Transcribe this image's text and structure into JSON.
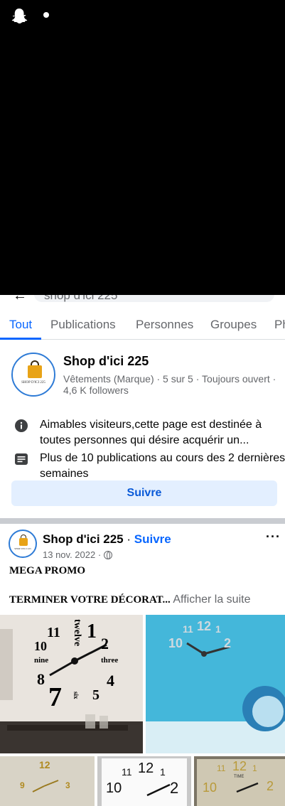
{
  "status_bar": {
    "icons": [
      "snapchat-ghost-icon",
      "notification-dot-icon"
    ]
  },
  "search": {
    "query": "shop d'ici 225"
  },
  "tabs": [
    {
      "label": "Tout",
      "active": true
    },
    {
      "label": "Publications",
      "active": false
    },
    {
      "label": "Personnes",
      "active": false
    },
    {
      "label": "Groupes",
      "active": false
    },
    {
      "label": "Ph",
      "active": false
    }
  ],
  "page_result": {
    "name": "Shop d'ici 225",
    "subtitle": "Vêtements (Marque) · 5 sur 5 · Toujours ouvert · 4,6 K followers",
    "logo_text": "SHOP D'ICI 225",
    "info_about": "Aimables visiteurs,cette page est destinée à toutes personnes qui désire acquérir un...",
    "info_activity": "Plus de 10 publications au cours des 2 dernières semaines",
    "follow_label": "Suivre"
  },
  "post": {
    "author": "Shop d'ici 225",
    "separator": " · ",
    "follow_label": "Suivre",
    "date": "13 nov. 2022 · ",
    "more_label": "···",
    "line1": "MEGA PROMO",
    "line2": "TERMINER VOTRE DÉCORAT...",
    "see_more": " Afficher la suite",
    "clock1": {
      "twelve": "twelve",
      "eleven": "11",
      "one": "1",
      "two": "2",
      "ten": "10",
      "nine": "nine",
      "three": "three",
      "eight": "8",
      "four": "4",
      "seven": "7",
      "six": "six",
      "five": "5"
    },
    "clock2": {
      "twelve": "12",
      "eleven": "11",
      "one": "1",
      "ten": "10",
      "two": "2"
    },
    "clock3": {
      "twelve": "12",
      "nine": "9",
      "three": "3"
    },
    "clock4": {
      "eleven": "11",
      "twelve": "12",
      "one": "1",
      "ten": "10",
      "two": "2"
    },
    "clock5": {
      "twelve": "12",
      "eleven": "11",
      "one": "1",
      "ten": "10",
      "two": "2",
      "brand": "TIME"
    }
  },
  "colors": {
    "accent": "#0866ff",
    "follow_bg": "#e3efff",
    "separator": "#c9ccd1"
  }
}
